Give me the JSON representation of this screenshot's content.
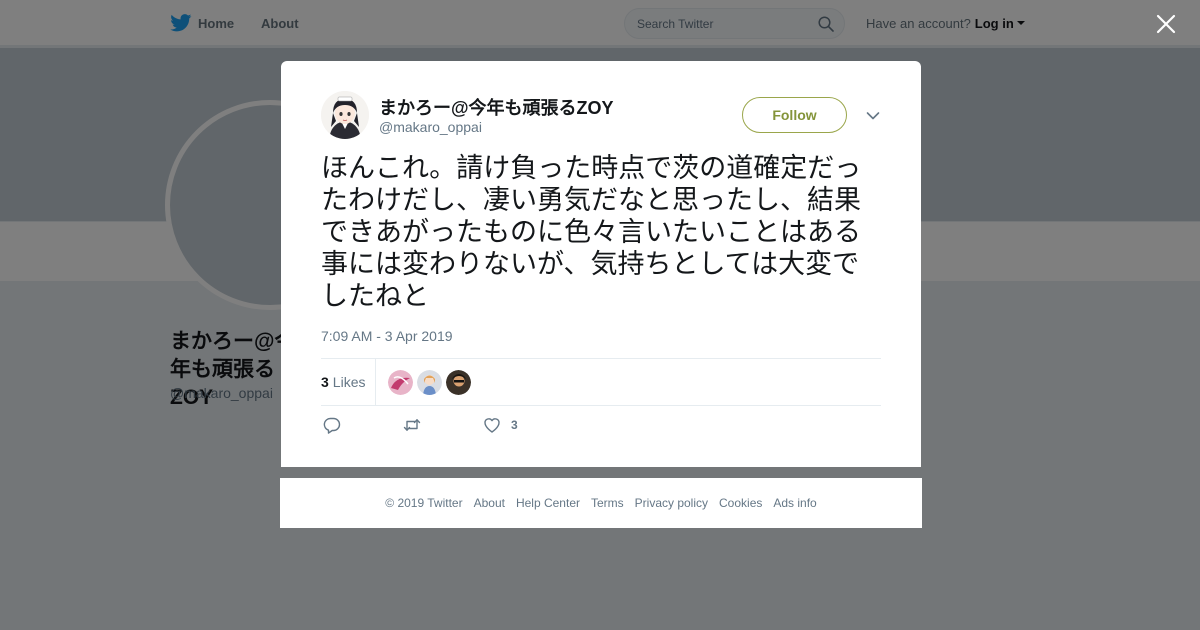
{
  "topbar": {
    "home_label": "Home",
    "about_label": "About",
    "search_placeholder": "Search Twitter",
    "account_prompt": "Have an account?",
    "login_label": "Log in"
  },
  "profile": {
    "name": "まかろー@今年も頑張るZOY",
    "handle": "@makaro_oppai"
  },
  "tweet": {
    "display_name": "まかろー@今年も頑張るZOY",
    "screen_name": "@makaro_oppai",
    "follow_label": "Follow",
    "text": "ほんこれ。請け負った時点で茨の道確定だったわけだし、凄い勇気だなと思ったし、結果できあがったものに色々言いたいことはある事には変わりないが、気持ちとしては大変でしたねと",
    "timestamp": "7:09 AM - 3 Apr 2019",
    "likes_count": "3",
    "likes_label": "Likes",
    "like_action_count": "3"
  },
  "footer": {
    "links": [
      "© 2019 Twitter",
      "About",
      "Help Center",
      "Terms",
      "Privacy policy",
      "Cookies",
      "Ads info"
    ]
  },
  "colors": {
    "twitter_blue": "#1da1f2",
    "follow_accent": "#84943a",
    "secondary_text": "#657786",
    "overlay": "rgba(0,0,0,0.5)"
  },
  "icons": [
    "twitter-bird-icon",
    "search-icon",
    "caret-down-icon",
    "close-icon",
    "chevron-down-icon",
    "reply-icon",
    "retweet-icon",
    "heart-icon"
  ]
}
